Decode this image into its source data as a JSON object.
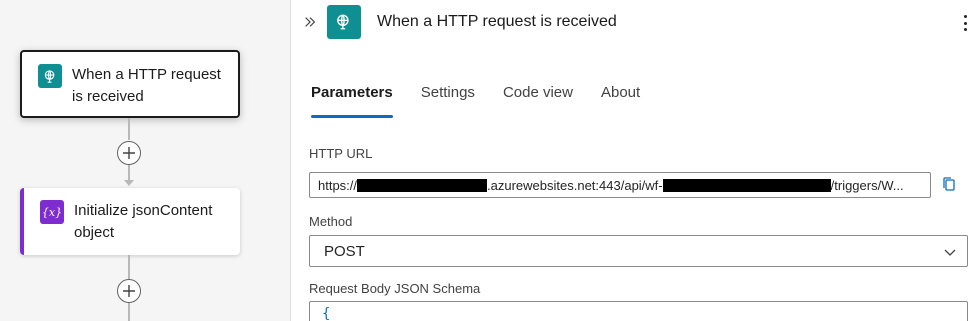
{
  "canvas": {
    "nodes": [
      {
        "title": "When a HTTP request is received",
        "icon": "http-request-icon"
      },
      {
        "title": "Initialize jsonContent object",
        "icon": "variable-icon",
        "icon_glyph": "{x}"
      }
    ]
  },
  "panel": {
    "title": "When a HTTP request is received",
    "icon": "http-request-icon",
    "tabs": [
      "Parameters",
      "Settings",
      "Code view",
      "About"
    ],
    "active_tab": "Parameters",
    "http_url": {
      "label": "HTTP URL",
      "part1": "https://",
      "part2": ".azurewebsites.net:443/api/wf-",
      "part3": "/triggers/W..."
    },
    "method": {
      "label": "Method",
      "value": "POST"
    },
    "schema": {
      "label": "Request Body JSON Schema",
      "value": "{"
    }
  },
  "colors": {
    "http_icon": "#0f8f91",
    "variable_icon": "#7e2bd0",
    "active_tab_underline": "#0f6cbd"
  }
}
